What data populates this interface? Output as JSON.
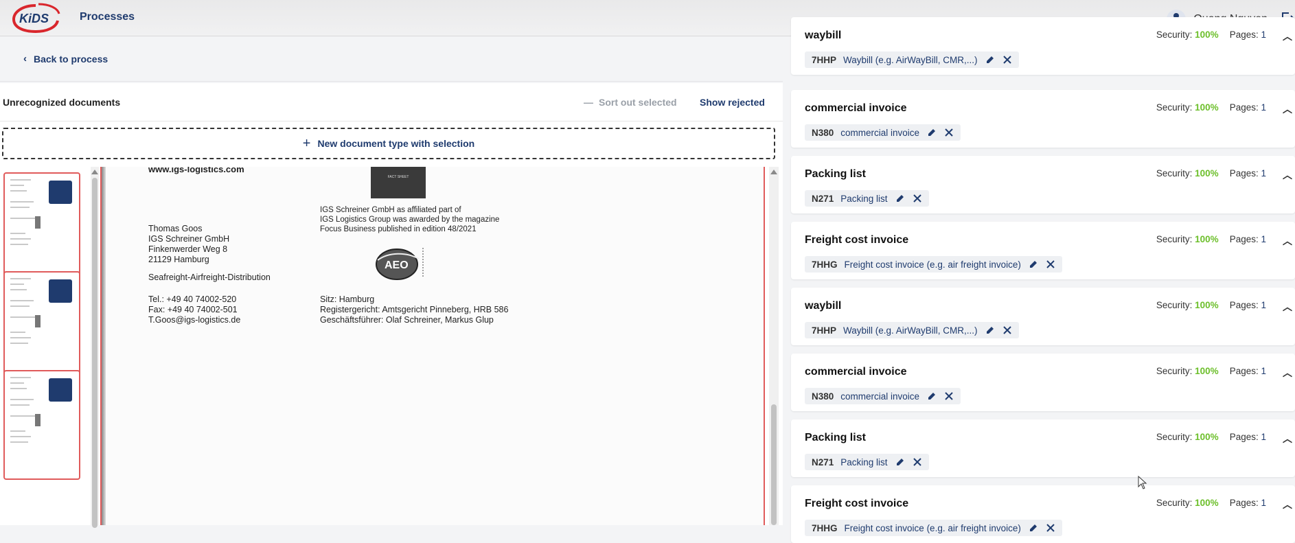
{
  "header": {
    "logo_text": "KiDS",
    "app_title": "Processes",
    "user_name": "Quang Nguyen"
  },
  "nav": {
    "back_label": "Back to process"
  },
  "unrecognized": {
    "title": "Unrecognized documents",
    "sort_out_label": "Sort out selected",
    "show_rejected_label": "Show rejected",
    "new_type_label": "New document type with selection"
  },
  "document_page": {
    "url_line": "www.igs-logistics.com",
    "contact_lines": "Thomas Goos\nIGS Schreiner GmbH\nFinkenwerder Weg 8\n21129 Hamburg",
    "service_line": "Seafreight-Airfreight-Distribution",
    "phone_lines": "Tel.: +49 40 74002-520\nFax: +49 40 74002-501\nT.Goos@igs-logistics.de",
    "award_lines": "IGS Schreiner GmbH as affiliated part of\nIGS Logistics Group was awarded by the magazine\nFocus Business published in edition 48/2021",
    "seat_lines": "Sitz: Hamburg\nRegistergericht: Amtsgericht Pinneberg, HRB 586\nGeschäftsführer: Olaf Schreiner, Markus Glup",
    "seal_text": "FACT SHEET",
    "aeo_text": "AEO"
  },
  "labels": {
    "security": "Security:",
    "pages": "Pages:"
  },
  "cards": [
    {
      "name": "waybill",
      "security": "100%",
      "pages": "1",
      "code": "7HHP",
      "type_label": "Waybill (e.g. AirWayBill, CMR,...)"
    },
    {
      "name": "commercial invoice",
      "security": "100%",
      "pages": "1",
      "code": "N380",
      "type_label": "commercial invoice"
    },
    {
      "name": "Packing list",
      "security": "100%",
      "pages": "1",
      "code": "N271",
      "type_label": "Packing list"
    },
    {
      "name": "Freight cost invoice",
      "security": "100%",
      "pages": "1",
      "code": "7HHG",
      "type_label": "Freight cost invoice (e.g. air freight invoice)"
    },
    {
      "name": "waybill",
      "security": "100%",
      "pages": "1",
      "code": "7HHP",
      "type_label": "Waybill (e.g. AirWayBill, CMR,...)"
    },
    {
      "name": "commercial invoice",
      "security": "100%",
      "pages": "1",
      "code": "N380",
      "type_label": "commercial invoice"
    },
    {
      "name": "Packing list",
      "security": "100%",
      "pages": "1",
      "code": "N271",
      "type_label": "Packing list"
    },
    {
      "name": "Freight cost invoice",
      "security": "100%",
      "pages": "1",
      "code": "7HHG",
      "type_label": "Freight cost invoice (e.g. air freight invoice)"
    }
  ],
  "colors": {
    "brand": "#1f3b6e",
    "security_ok": "#6cbf2a",
    "selection_border": "#e05a5a"
  }
}
